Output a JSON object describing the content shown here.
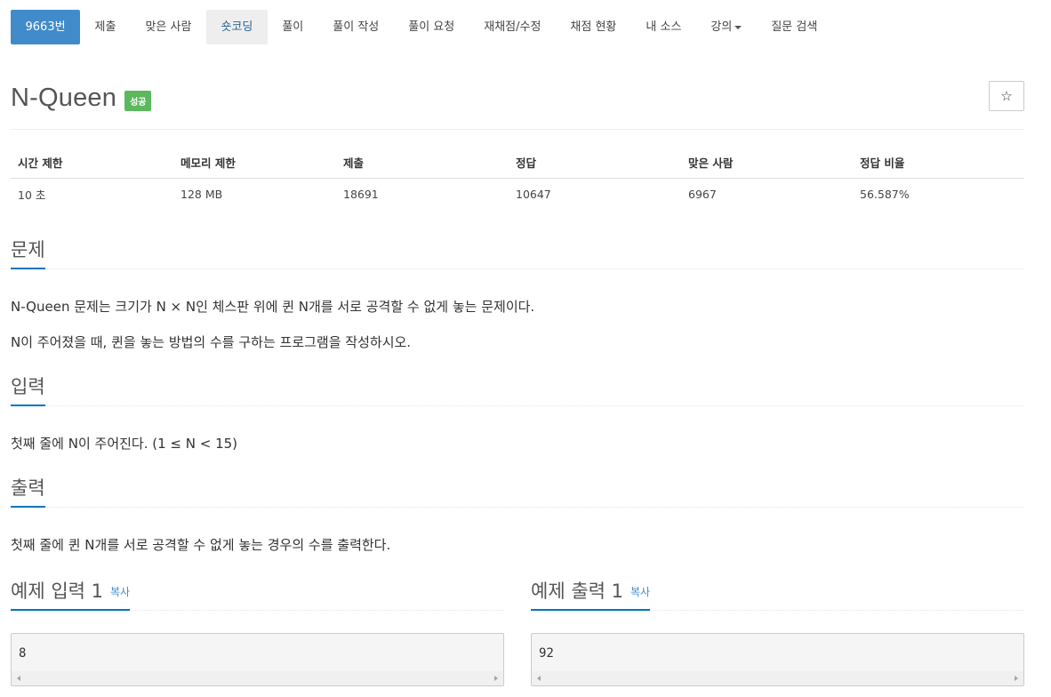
{
  "tabs": [
    {
      "label": "9663번",
      "state": "active"
    },
    {
      "label": "제출",
      "state": ""
    },
    {
      "label": "맞은 사람",
      "state": ""
    },
    {
      "label": "숏코딩",
      "state": "current"
    },
    {
      "label": "풀이",
      "state": ""
    },
    {
      "label": "풀이 작성",
      "state": ""
    },
    {
      "label": "풀이 요청",
      "state": ""
    },
    {
      "label": "재채점/수정",
      "state": ""
    },
    {
      "label": "채점 현황",
      "state": ""
    },
    {
      "label": "내 소스",
      "state": ""
    },
    {
      "label": "강의",
      "state": "dropdown"
    },
    {
      "label": "질문 검색",
      "state": ""
    }
  ],
  "problem": {
    "title": "N-Queen",
    "badge": "성공",
    "star": "☆"
  },
  "info_table": {
    "headers": [
      "시간 제한",
      "메모리 제한",
      "제출",
      "정답",
      "맞은 사람",
      "정답 비율"
    ],
    "values": [
      "10 초",
      "128 MB",
      "18691",
      "10647",
      "6967",
      "56.587%"
    ]
  },
  "sections": {
    "problem_heading": "문제",
    "problem_p1": "N-Queen 문제는 크기가 N × N인 체스판 위에 퀸 N개를 서로 공격할 수 없게 놓는 문제이다.",
    "problem_p2": "N이 주어졌을 때, 퀸을 놓는 방법의 수를 구하는 프로그램을 작성하시오.",
    "input_heading": "입력",
    "input_text": "첫째 줄에 N이 주어진다. (1 ≤ N < 15)",
    "output_heading": "출력",
    "output_text": "첫째 줄에 퀸 N개를 서로 공격할 수 없게 놓는 경우의 수를 출력한다."
  },
  "samples": {
    "input_heading": "예제 입력 1",
    "output_heading": "예제 출력 1",
    "copy_label": "복사",
    "input_value": "8",
    "output_value": "92"
  },
  "colors": {
    "accent": "#428bca",
    "success": "#5cb85c",
    "underline": "#0076c0"
  }
}
